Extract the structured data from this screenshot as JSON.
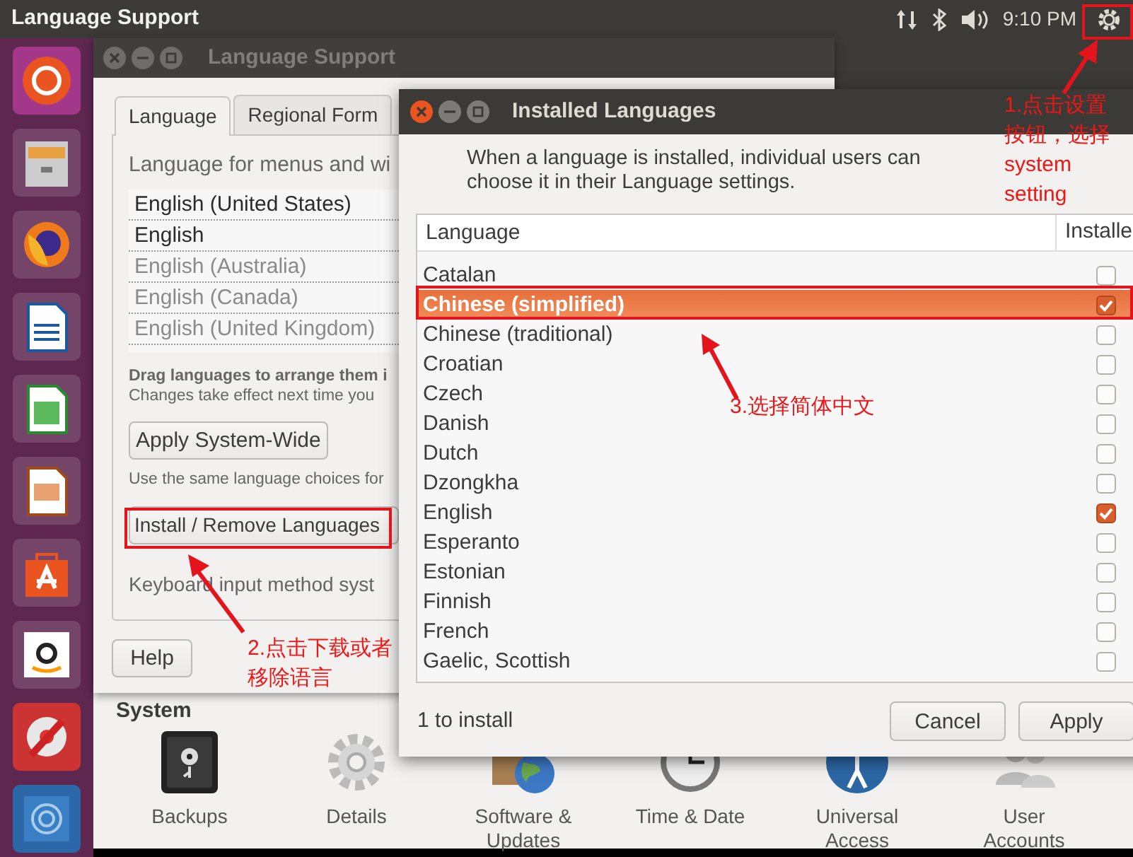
{
  "top_panel": {
    "title": "Language Support",
    "time": "9:10 PM"
  },
  "language_support": {
    "title": "Language Support",
    "tabs": [
      {
        "label": "Language",
        "selected": true
      },
      {
        "label": "Regional Form",
        "selected": false
      }
    ],
    "menu_label": "Language for menus and wi",
    "languages": [
      {
        "name": "English (United States)",
        "active": true
      },
      {
        "name": "English",
        "active": true
      },
      {
        "name": "English (Australia)",
        "active": false
      },
      {
        "name": "English (Canada)",
        "active": false
      },
      {
        "name": "English (United Kingdom)",
        "active": false
      }
    ],
    "drag_hint": "Drag languages to arrange them i",
    "drag_note": "Changes take effect next time you",
    "apply_button": "Apply System-Wide",
    "apply_note": "Use the same language choices for",
    "install_button": "Install / Remove Languages",
    "keyboard_label": "Keyboard input method syst",
    "help_button": "Help"
  },
  "system_settings": {
    "section": "System",
    "items": [
      {
        "label": "Backups",
        "kind": "safe"
      },
      {
        "label": "Details",
        "kind": "gear"
      },
      {
        "label": "Software & Updates",
        "kind": "globe"
      },
      {
        "label": "Time & Date",
        "kind": "clock"
      },
      {
        "label": "Universal Access",
        "kind": "access"
      },
      {
        "label": "User Accounts",
        "kind": "users"
      }
    ]
  },
  "dialog": {
    "title": "Installed Languages",
    "message": "When a language is installed, individual users can choose it in their Language settings.",
    "columns": [
      "Language",
      "Installe"
    ],
    "rows": [
      {
        "name": "Catalan",
        "installed": false,
        "selected": false
      },
      {
        "name": "Chinese (simplified)",
        "installed": true,
        "selected": true
      },
      {
        "name": "Chinese (traditional)",
        "installed": false,
        "selected": false
      },
      {
        "name": "Croatian",
        "installed": false,
        "selected": false
      },
      {
        "name": "Czech",
        "installed": false,
        "selected": false
      },
      {
        "name": "Danish",
        "installed": false,
        "selected": false
      },
      {
        "name": "Dutch",
        "installed": false,
        "selected": false
      },
      {
        "name": "Dzongkha",
        "installed": false,
        "selected": false
      },
      {
        "name": "English",
        "installed": true,
        "selected": false
      },
      {
        "name": "Esperanto",
        "installed": false,
        "selected": false
      },
      {
        "name": "Estonian",
        "installed": false,
        "selected": false
      },
      {
        "name": "Finnish",
        "installed": false,
        "selected": false
      },
      {
        "name": "French",
        "installed": false,
        "selected": false
      },
      {
        "name": "Gaelic, Scottish",
        "installed": false,
        "selected": false
      }
    ],
    "status": "1 to install",
    "buttons": [
      "Cancel",
      "Apply"
    ]
  },
  "annotations": [
    {
      "lines": [
        "1.点击设置",
        "按钮，选择",
        "system",
        "setting"
      ]
    },
    {
      "lines": [
        "2.点击下载或者",
        "移除语言"
      ]
    },
    {
      "lines": [
        "3.选择简体中文"
      ]
    }
  ]
}
